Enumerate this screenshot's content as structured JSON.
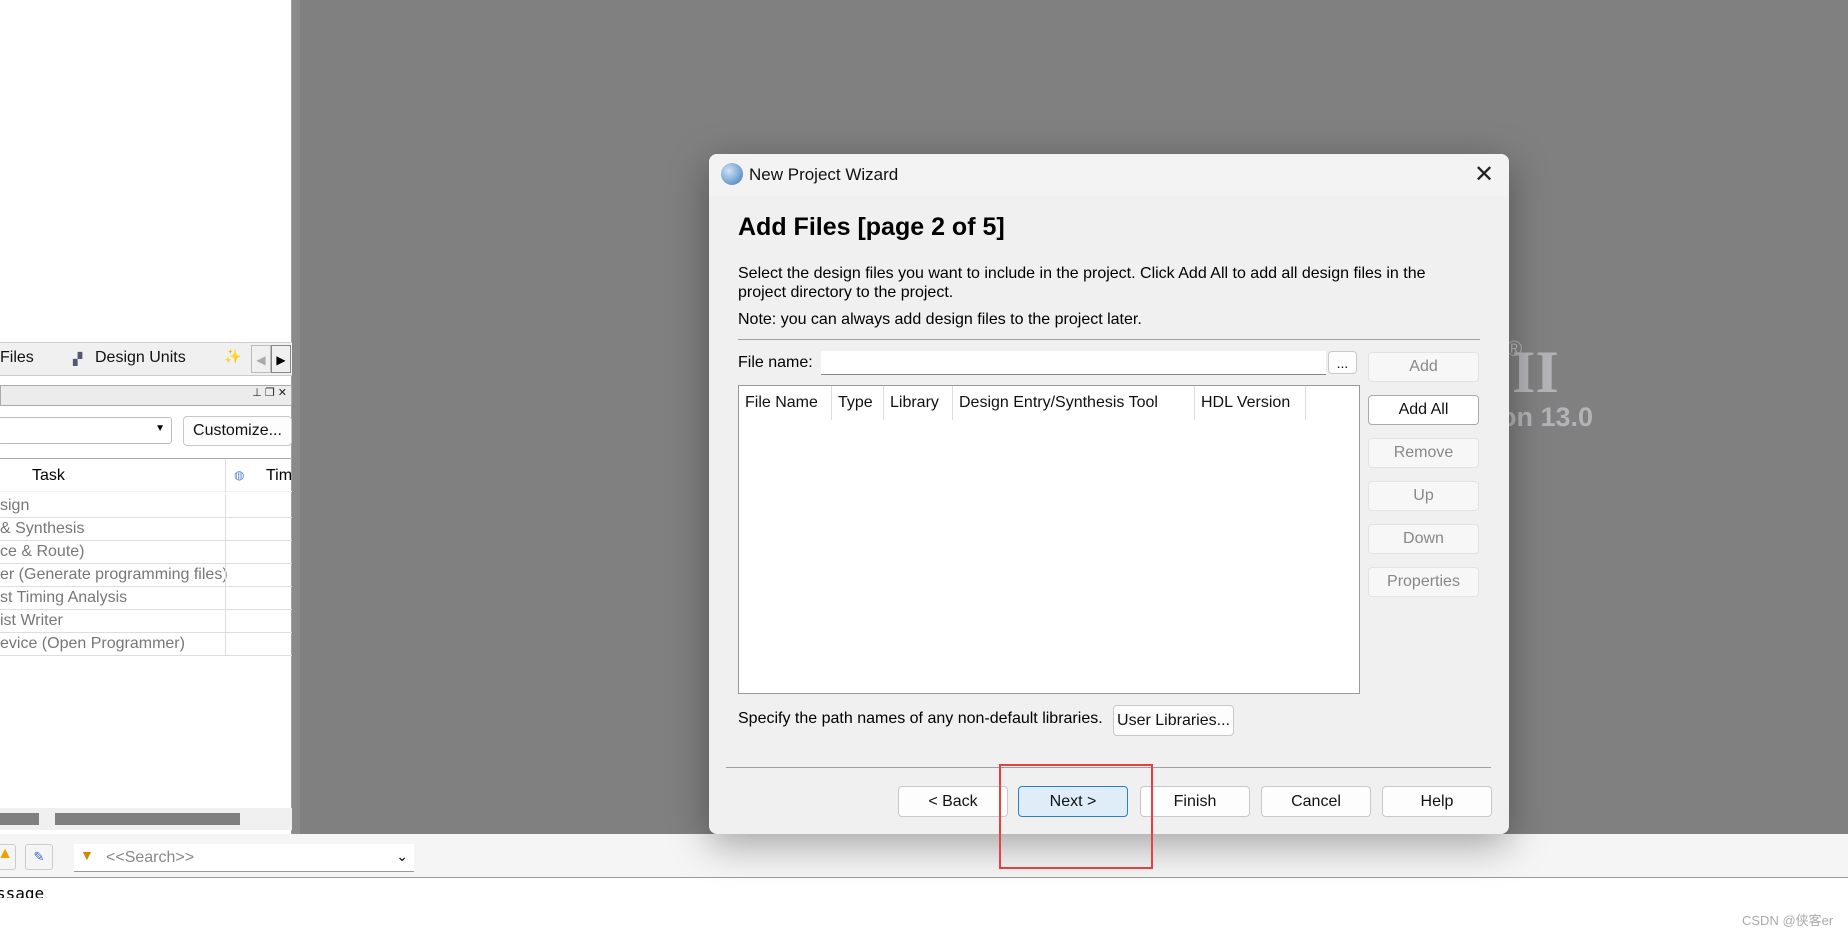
{
  "left_panel": {
    "tabs": [
      {
        "label": "Files"
      },
      {
        "label": "Design Units"
      }
    ],
    "customize_label": "Customize...",
    "table": {
      "headers": [
        "Task",
        "Tim"
      ],
      "rows": [
        "sign",
        "& Synthesis",
        "ce & Route)",
        "er (Generate programming files)",
        "st Timing Analysis",
        "ist Writer",
        "evice (Open Programmer)"
      ]
    }
  },
  "bottom": {
    "search_placeholder": "<<Search>>",
    "message_label": "ssage"
  },
  "backdrop": {
    "logo_fragment": "II",
    "registered": "®",
    "version_fragment": "on 13.0"
  },
  "dialog": {
    "title": "New Project Wizard",
    "heading": "Add Files [page 2 of 5]",
    "description": "Select the design files you want to include in the project. Click Add All to add all design files in the project directory to the project.",
    "note": "Note: you can always add design files to the project later.",
    "file_name_label": "File name:",
    "file_name_value": "",
    "browse_label": "...",
    "columns": [
      "File Name",
      "Type",
      "Library",
      "Design Entry/Synthesis Tool",
      "HDL Version"
    ],
    "side_buttons": [
      {
        "label": "Add",
        "enabled": false
      },
      {
        "label": "Add All",
        "enabled": true
      },
      {
        "label": "Remove",
        "enabled": false
      },
      {
        "label": "Up",
        "enabled": false
      },
      {
        "label": "Down",
        "enabled": false
      },
      {
        "label": "Properties",
        "enabled": false
      }
    ],
    "libraries_text": "Specify the path names of any non-default libraries.",
    "user_libraries_label": "User Libraries...",
    "footer_buttons": [
      {
        "label": "< Back"
      },
      {
        "label": "Next >"
      },
      {
        "label": "Finish"
      },
      {
        "label": "Cancel"
      },
      {
        "label": "Help"
      }
    ],
    "highlight_color": "#e84040"
  },
  "watermark": "CSDN @侠客er"
}
